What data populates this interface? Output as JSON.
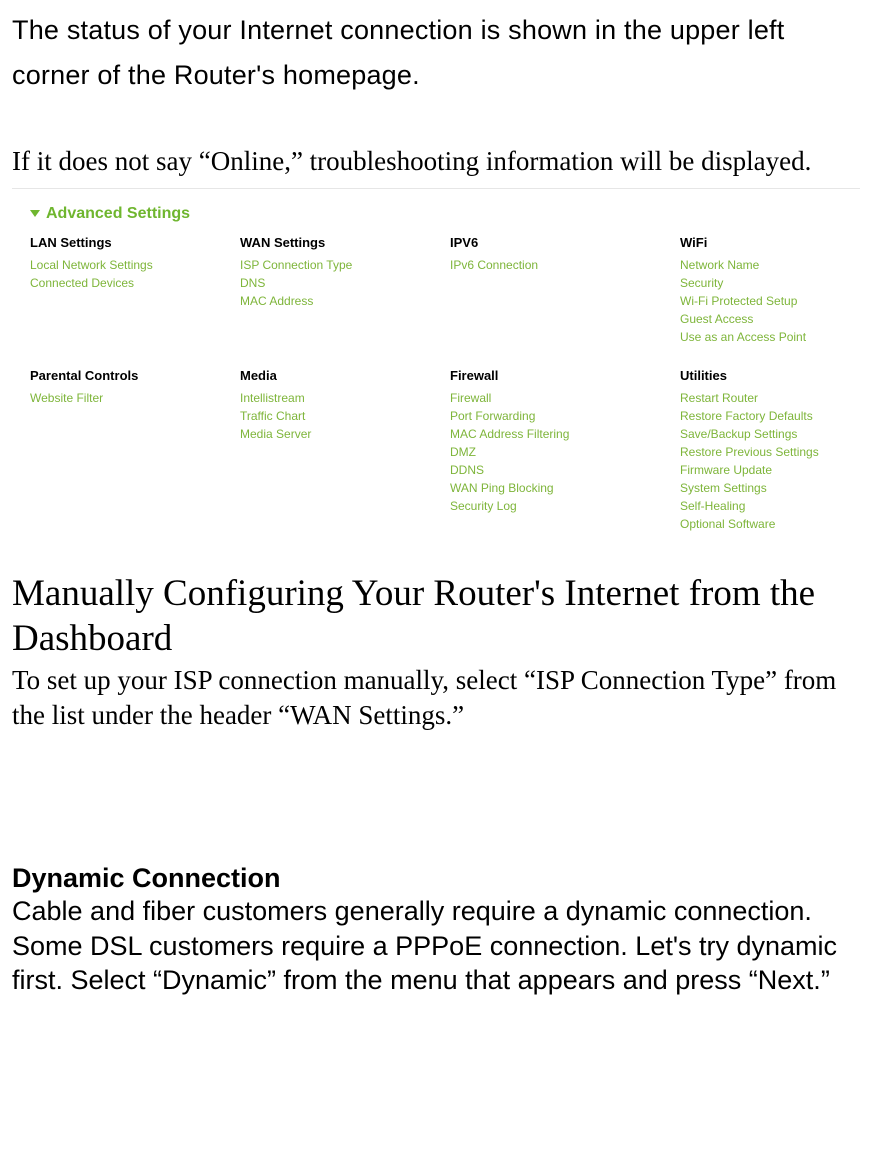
{
  "intro1": "The status of your Internet connection is shown in the upper left corner of the Router's homepage.",
  "intro2": "If it does not say “Online,” troubleshooting information will be displayed.",
  "panel": {
    "title": "Advanced Settings",
    "row1": {
      "lan": {
        "head": "LAN Settings",
        "items": [
          "Local Network Settings",
          "Connected Devices"
        ]
      },
      "wan": {
        "head": "WAN Settings",
        "items": [
          "ISP Connection Type",
          "DNS",
          "MAC Address"
        ]
      },
      "ipv6": {
        "head": "IPV6",
        "items": [
          "IPv6 Connection"
        ]
      },
      "wifi": {
        "head": "WiFi",
        "items": [
          "Network Name",
          "Security",
          "Wi-Fi Protected Setup",
          "Guest Access",
          "Use as an Access Point"
        ]
      }
    },
    "row2": {
      "parental": {
        "head": "Parental Controls",
        "items": [
          "Website Filter"
        ]
      },
      "media": {
        "head": "Media",
        "items": [
          "Intellistream",
          "Traffic Chart",
          "Media Server"
        ]
      },
      "firewall": {
        "head": "Firewall",
        "items": [
          "Firewall",
          "Port Forwarding",
          "MAC Address Filtering",
          "DMZ",
          "DDNS",
          "WAN Ping Blocking",
          "Security Log"
        ]
      },
      "utilities": {
        "head": "Utilities",
        "items": [
          "Restart Router",
          "Restore Factory Defaults",
          "Save/Backup Settings",
          "Restore Previous Settings",
          "Firmware Update",
          "System Settings",
          "Self-Healing",
          "Optional Software"
        ]
      }
    }
  },
  "h2": "Manually Configuring Your Router's Internet from the Dashboard",
  "p_serif": "To set up your ISP connection manually, select “ISP Connection Type” from the list under the header “WAN Settings.”",
  "h3": "Dynamic Connection",
  "p_sans": "Cable and fiber customers generally require a dynamic connection. Some DSL customers require a PPPoE connection. Let's try dynamic first. Select “Dynamic” from the menu that appears and press “Next.”"
}
